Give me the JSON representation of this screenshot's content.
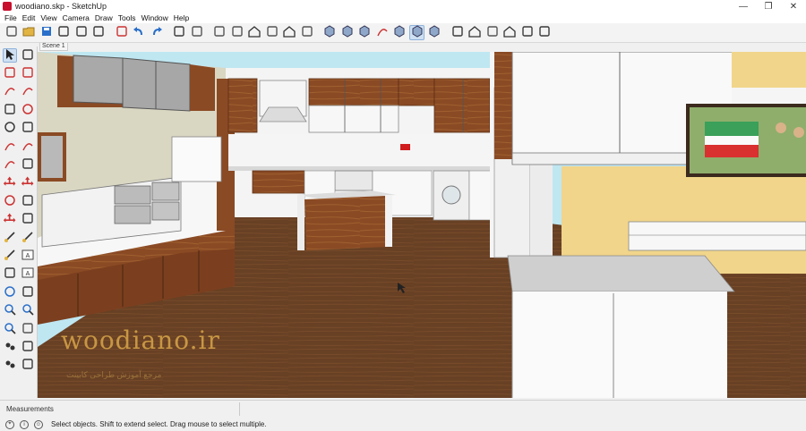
{
  "window": {
    "title": "woodiano.skp - SketchUp",
    "controls": [
      "minimize-icon",
      "maximize-icon",
      "close-icon"
    ],
    "control_glyphs": [
      "—",
      "❐",
      "✕"
    ]
  },
  "menu": [
    "File",
    "Edit",
    "View",
    "Camera",
    "Draw",
    "Tools",
    "Window",
    "Help"
  ],
  "toolbar": {
    "buttons": [
      "new-model-icon",
      "open-folder-icon",
      "save-icon",
      "cut-icon",
      "copy-icon",
      "paste-icon",
      "erase-icon",
      "undo-icon",
      "redo-icon",
      "print-icon",
      "model-info-icon",
      "iso-view-icon",
      "top-view-icon",
      "front-view-icon",
      "right-view-icon",
      "back-view-icon",
      "left-view-icon",
      "xray-icon",
      "back-edges-icon",
      "wireframe-icon",
      "hidden-line-icon",
      "shaded-icon",
      "shaded-textures-icon",
      "monochrome-icon",
      "component-icon",
      "warehouse-icon",
      "share-model-icon",
      "extension-warehouse-icon",
      "layout-icon",
      "style-builder-icon"
    ],
    "active": "shaded-textures-icon"
  },
  "scene": {
    "tab_label": "Scene 1"
  },
  "palette": {
    "tools": [
      "select-icon",
      "make-component-icon",
      "paint-bucket-icon",
      "eraser-icon",
      "line-icon",
      "freehand-icon",
      "rectangle-icon",
      "rotated-rectangle-icon",
      "circle-icon",
      "polygon-icon",
      "arc-icon",
      "two-point-arc-icon",
      "three-point-arc-icon",
      "pie-icon",
      "move-icon",
      "push-pull-icon",
      "rotate-icon",
      "follow-me-icon",
      "scale-icon",
      "offset-icon",
      "tape-measure-icon",
      "dimension-icon",
      "protractor-icon",
      "text-icon",
      "axes-icon",
      "3d-text-icon",
      "orbit-icon",
      "pan-icon",
      "zoom-icon",
      "zoom-window-icon",
      "zoom-extents-icon",
      "previous-view-icon",
      "position-camera-icon",
      "look-around-icon",
      "walk-icon",
      "section-plane-icon"
    ],
    "active": "select-icon"
  },
  "viewport": {
    "watermark": "woodiano.ir",
    "watermark_sub": "مرجع آموزش طراحی کابینت"
  },
  "measurements": {
    "label": "Measurements"
  },
  "status": {
    "icons": [
      "geo-location-icon",
      "credits-icon",
      "user-icon"
    ],
    "text": "Select objects. Shift to extend select. Drag mouse to select multiple."
  },
  "colors": {
    "floor": "#6b4226",
    "wood": "#8a4a24",
    "sky": "#bfe7f2",
    "wall_yellow": "#f1d58a",
    "accent_select": "#cfe0f3"
  }
}
